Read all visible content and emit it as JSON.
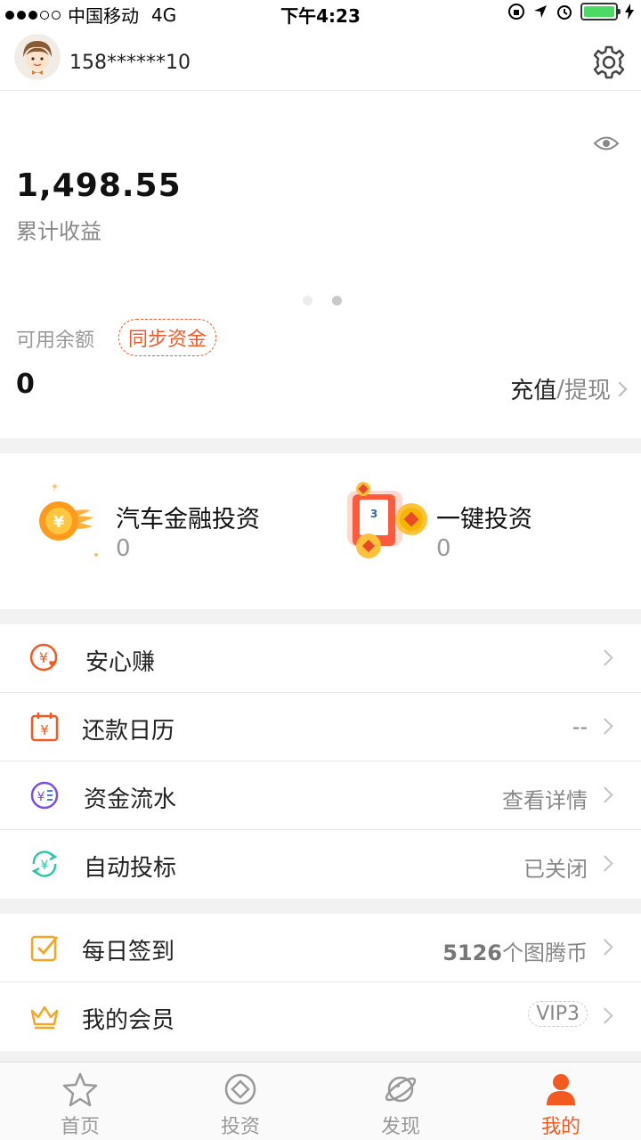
{
  "status_bar": {
    "carrier": "中国移动",
    "network": "4G",
    "time": "下午4:23"
  },
  "header": {
    "phone": "158******10"
  },
  "earnings": {
    "total_value": "1,498.55",
    "total_label": "累计收益",
    "available_label": "可用余额",
    "sync_button": "同步资金",
    "available_value": "0",
    "recharge_label": "充值",
    "slash": "/",
    "withdraw_label": "提现"
  },
  "invest": [
    {
      "title": "汽车金融投资",
      "value": "0"
    },
    {
      "title": "一键投资",
      "value": "0"
    }
  ],
  "menu_group1": [
    {
      "label": "安心赚",
      "value": ""
    },
    {
      "label": "还款日历",
      "value": "--"
    },
    {
      "label": "资金流水",
      "value": "查看详情"
    },
    {
      "label": "自动投标",
      "value": "已关闭"
    }
  ],
  "menu_group2": [
    {
      "label": "每日签到",
      "value_bold": "5126",
      "value": "个图腾币"
    },
    {
      "label": "我的会员",
      "value": "VIP3"
    }
  ],
  "tabs": [
    {
      "label": "首页"
    },
    {
      "label": "投资"
    },
    {
      "label": "发现"
    },
    {
      "label": "我的"
    }
  ],
  "colors": {
    "accent": "#f25a20",
    "sync_border": "#f05a2b",
    "battery": "#4cd964"
  }
}
